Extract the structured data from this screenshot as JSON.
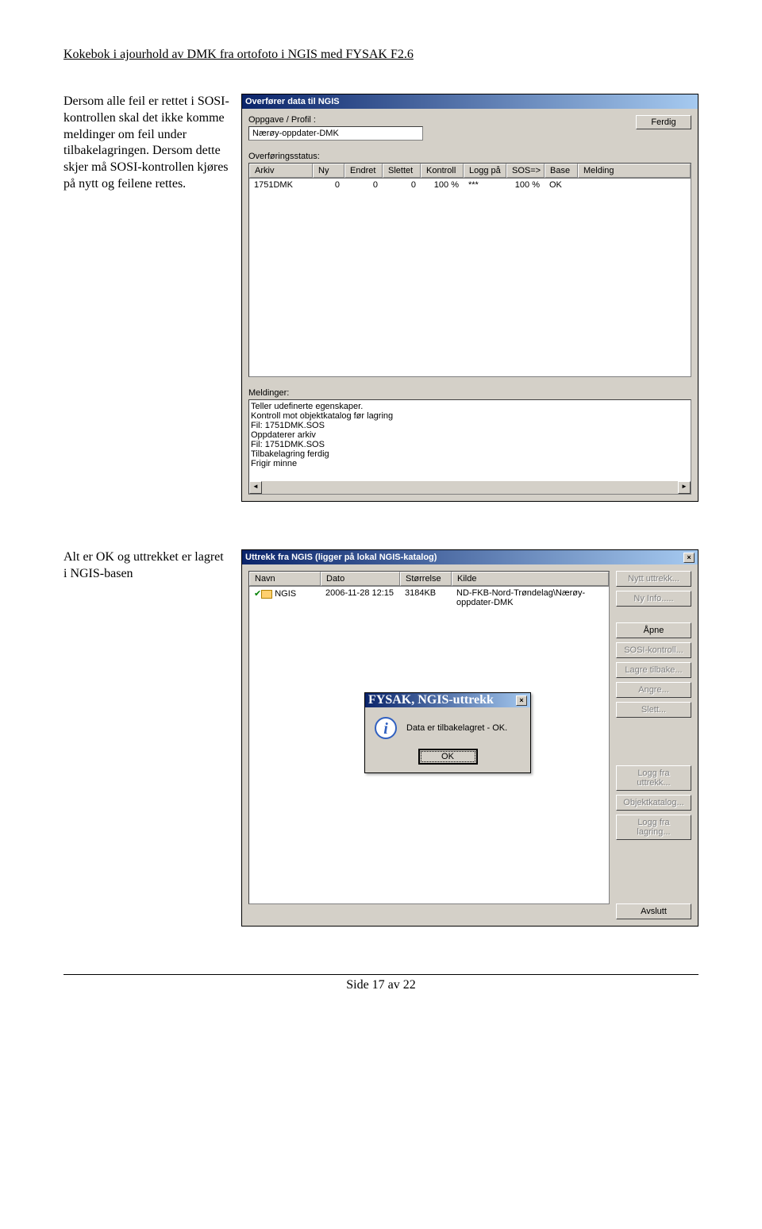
{
  "header": "Kokebok i ajourhold av DMK fra ortofoto i NGIS med FYSAK F2.6",
  "footer": "Side 17 av 22",
  "section1": {
    "text": "Dersom alle feil er rettet i SOSI-kontrollen skal det ikke komme meldinger om feil under tilbakelagringen. Dersom dette skjer må SOSI-kontrollen kjøres på nytt og feilene rettes.",
    "dialog": {
      "title": "Overfører data til NGIS",
      "label_oppgave": "Oppgave / Profil :",
      "value_oppgave": "Nærøy-oppdater-DMK",
      "btn_ferdig": "Ferdig",
      "label_status": "Overføringsstatus:",
      "cols": [
        "Arkiv",
        "Ny",
        "Endret",
        "Slettet",
        "Kontroll",
        "Logg på",
        "SOS=>",
        "Base",
        "Melding"
      ],
      "row": [
        "1751DMK",
        "0",
        "0",
        "0",
        "100 %",
        "***",
        "100 %",
        "OK",
        ""
      ],
      "label_meldinger": "Meldinger:",
      "messages": [
        "Teller udefinerte egenskaper.",
        "Kontroll mot objektkatalog før lagring",
        "Fil: 1751DMK.SOS",
        "Oppdaterer arkiv",
        "Fil: 1751DMK.SOS",
        "Tilbakelagring ferdig",
        "Frigir minne"
      ]
    }
  },
  "section2": {
    "text": "Alt er OK og uttrekket er lagret i NGIS-basen",
    "dialog": {
      "title": "Uttrekk fra NGIS (ligger på lokal NGIS-katalog)",
      "cols": [
        "Navn",
        "Dato",
        "Størrelse",
        "Kilde"
      ],
      "row": [
        "NGIS",
        "2006-11-28 12:15",
        "3184KB",
        "ND-FKB-Nord-Trøndelag\\Nærøy-oppdater-DMK"
      ],
      "buttons": {
        "nytt": "Nytt uttrekk...",
        "nyinfo": "Ny Info.....",
        "apne": "Åpne",
        "sosi": "SOSI-kontroll...",
        "lagre": "Lagre tilbake...",
        "angre": "Angre...",
        "slett": "Slett...",
        "logg_uttrekk": "Logg fra uttrekk...",
        "objektkatalog": "Objektkatalog...",
        "logg_lagring": "Logg fra lagring...",
        "avslutt": "Avslutt"
      },
      "msgbox": {
        "title": "FYSAK, NGIS-uttrekk",
        "text": "Data er tilbakelagret - OK.",
        "ok": "OK"
      }
    }
  }
}
